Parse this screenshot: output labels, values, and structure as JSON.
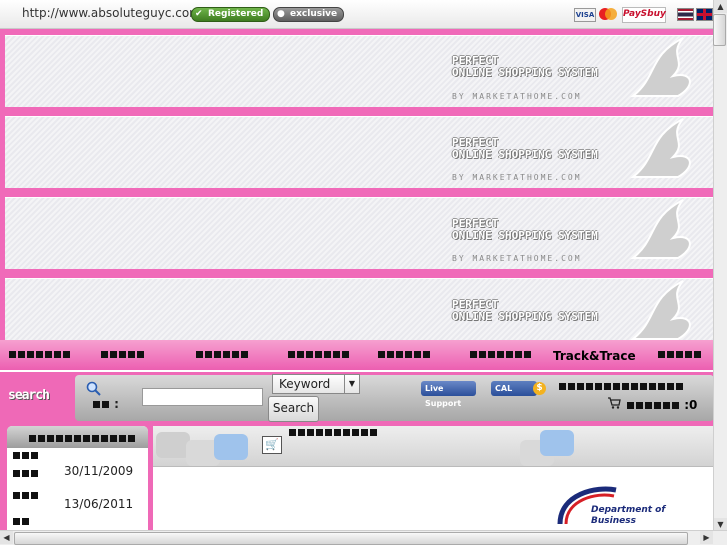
{
  "topbar": {
    "url": "http://www.absoluteguyc.com",
    "badge_registered": "Registered",
    "badge_exclusive": "exclusive",
    "pay_visa": "VISA",
    "pay_paysbuy": "PaySbuy"
  },
  "banner": {
    "title_line1": "PERFECT",
    "title_line2": "ONLINE SHOPPING SYSTEM",
    "subtitle": "BY MARKETATHOME.COM"
  },
  "nav": {
    "track": "Track&Trace"
  },
  "search": {
    "logo": "search",
    "input_value": "",
    "select_value": "Keyword",
    "button": "Search",
    "live_support": "Live Support",
    "cal": "CAL",
    "cart_count": ":0"
  },
  "stats": {
    "dates": [
      "30/11/2009",
      "13/06/2011"
    ]
  },
  "logo_dob": {
    "line1": "Department of",
    "line2": "Business"
  }
}
